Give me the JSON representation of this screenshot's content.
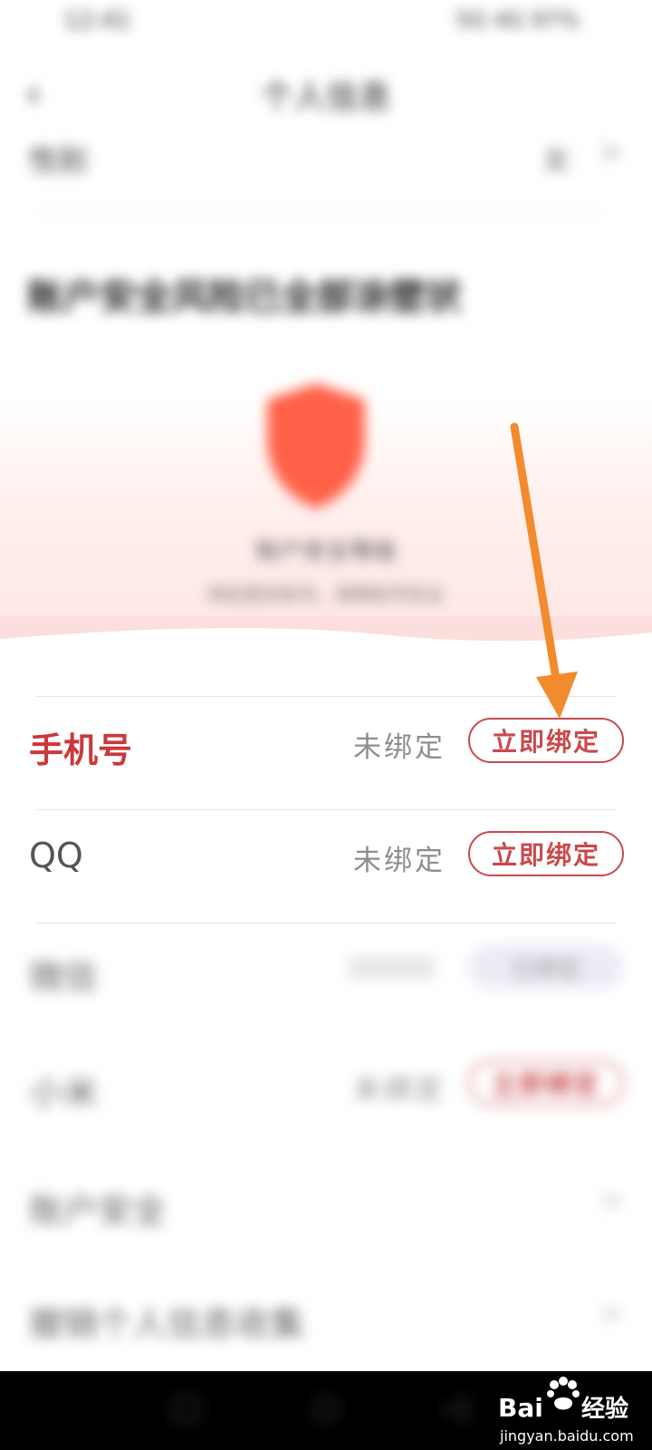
{
  "status_bar": {
    "time": "12:41",
    "right_text": "5G 4G 97%"
  },
  "header": {
    "title": "个人信息"
  },
  "gender_row": {
    "label": "性别",
    "value": "女",
    "chevron": ">"
  },
  "hero": {
    "heading": "账户安全风险已全部涂壁状",
    "security_label": "账户安全等级",
    "security_desc": "绑定更多账号，保障账号安全"
  },
  "rows": [
    {
      "label": "手机号",
      "status": "未绑定",
      "button": "立即绑定",
      "label_color": "#c8393b"
    },
    {
      "label": "QQ",
      "status": "未绑定",
      "button": "立即绑定",
      "label_color": "#555555"
    },
    {
      "label": "微信",
      "status": "已绑定",
      "button": "已绑定",
      "label_color": "#666666"
    },
    {
      "label": "小米",
      "status": "未绑定",
      "button": "立即绑定",
      "label_color": "#666666"
    }
  ],
  "menu": [
    {
      "label": "账户安全",
      "chevron": ">"
    },
    {
      "label": "撤销个人信息收集",
      "chevron": ">"
    }
  ],
  "nav": {
    "back": "◁",
    "home": "○",
    "recent": "□"
  },
  "watermark": {
    "brand": "Bai",
    "brand2": "经验",
    "url": "jingyan.baidu.com"
  },
  "colors": {
    "accent": "#c9494d",
    "arrow": "#f28a2e",
    "hero_pink": "#fde3e1"
  }
}
